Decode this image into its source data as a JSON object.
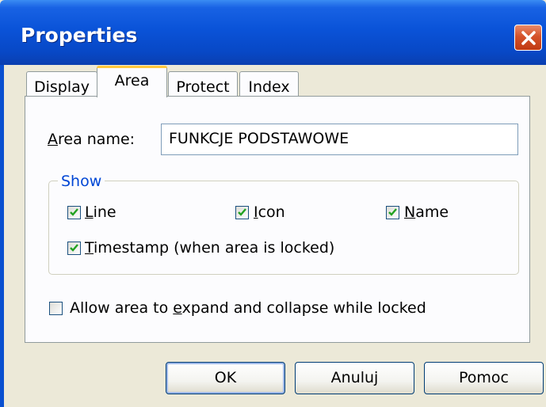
{
  "window": {
    "title": "Properties"
  },
  "tabs": [
    {
      "label": "Display"
    },
    {
      "label": "Area"
    },
    {
      "label": "Protect"
    },
    {
      "label": "Index"
    }
  ],
  "area_name": {
    "label_mnemonic": "A",
    "label_rest": "rea name:",
    "value": "FUNKCJE PODSTAWOWE"
  },
  "show_group": {
    "legend": "Show",
    "checkboxes": [
      {
        "mnemonic": "L",
        "rest": "ine",
        "checked": true
      },
      {
        "mnemonic": "I",
        "rest": "con",
        "checked": true
      },
      {
        "mnemonic": "N",
        "rest": "ame",
        "checked": true
      },
      {
        "mnemonic": "T",
        "rest": "imestamp (when area is locked)",
        "checked": true
      }
    ]
  },
  "allow_expand": {
    "prefix": "Allow area to ",
    "mnemonic": "e",
    "rest": "xpand and collapse while locked",
    "checked": false
  },
  "buttons": {
    "ok": "OK",
    "cancel": "Anuluj",
    "help": "Pomoc"
  },
  "colors": {
    "titlebar": "#0a53d8",
    "dialog_bg": "#ece9d8",
    "group_legend": "#0046d5",
    "check": "#21a121",
    "tab_highlight": "#ffc83c"
  }
}
